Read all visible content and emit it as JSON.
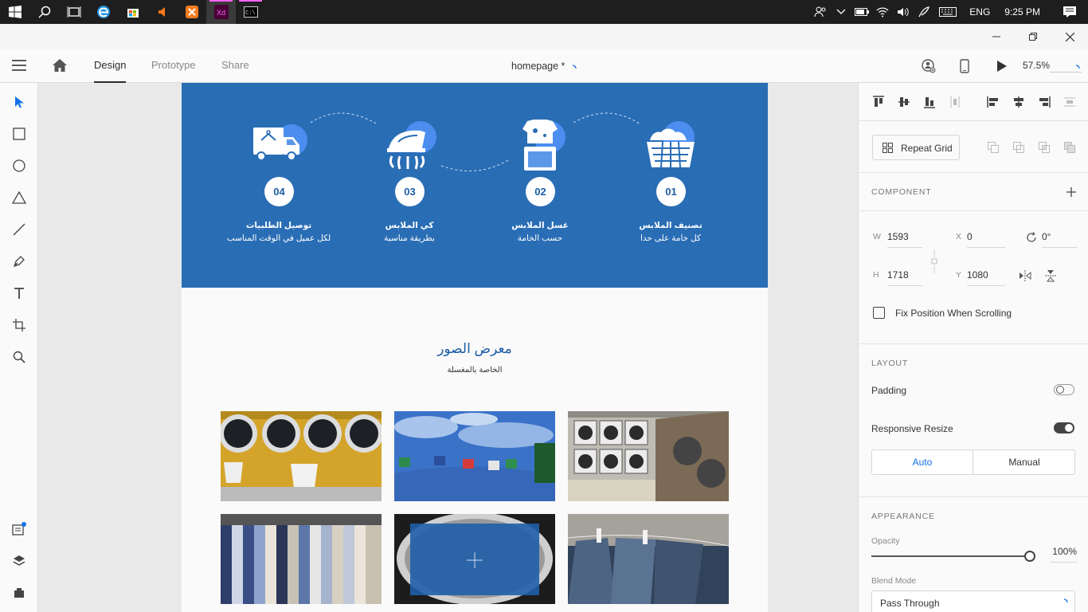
{
  "taskbar": {
    "language": "ENG",
    "clock": "9:25 PM"
  },
  "appbar": {
    "tabs": [
      "Design",
      "Prototype",
      "Share"
    ],
    "doc_title": "homepage *",
    "zoom": "57.5%"
  },
  "artboard": {
    "steps": [
      {
        "num": "04",
        "title": "توصيل الطلبيات",
        "subtitle": "لكل عميل في الوقت المناسب"
      },
      {
        "num": "03",
        "title": "كي الملابس",
        "subtitle": "بطريقة مناسبة"
      },
      {
        "num": "02",
        "title": "غسل الملابس",
        "subtitle": "حسب الخامة"
      },
      {
        "num": "01",
        "title": "تصنيف الملابس",
        "subtitle": "كل خامة على حدا"
      }
    ],
    "gallery_title": "معرض الصور",
    "gallery_subtitle": "الخاصة بالمغسلة",
    "colors": {
      "band": "#296db5",
      "accent": "#1c5da6"
    }
  },
  "panel": {
    "repeat_grid": "Repeat Grid",
    "component_label": "COMPONENT",
    "w_label": "W",
    "w_value": "1593",
    "x_label": "X",
    "x_value": "0",
    "rotation_value": "0°",
    "h_label": "H",
    "h_value": "1718",
    "y_label": "Y",
    "y_value": "1080",
    "fix_position": "Fix Position When Scrolling",
    "layout_label": "LAYOUT",
    "padding_label": "Padding",
    "responsive_label": "Responsive Resize",
    "auto_label": "Auto",
    "manual_label": "Manual",
    "appearance_label": "APPEARANCE",
    "opacity_label": "Opacity",
    "opacity_value": "100%",
    "blend_label": "Blend Mode",
    "blend_value": "Pass Through"
  }
}
